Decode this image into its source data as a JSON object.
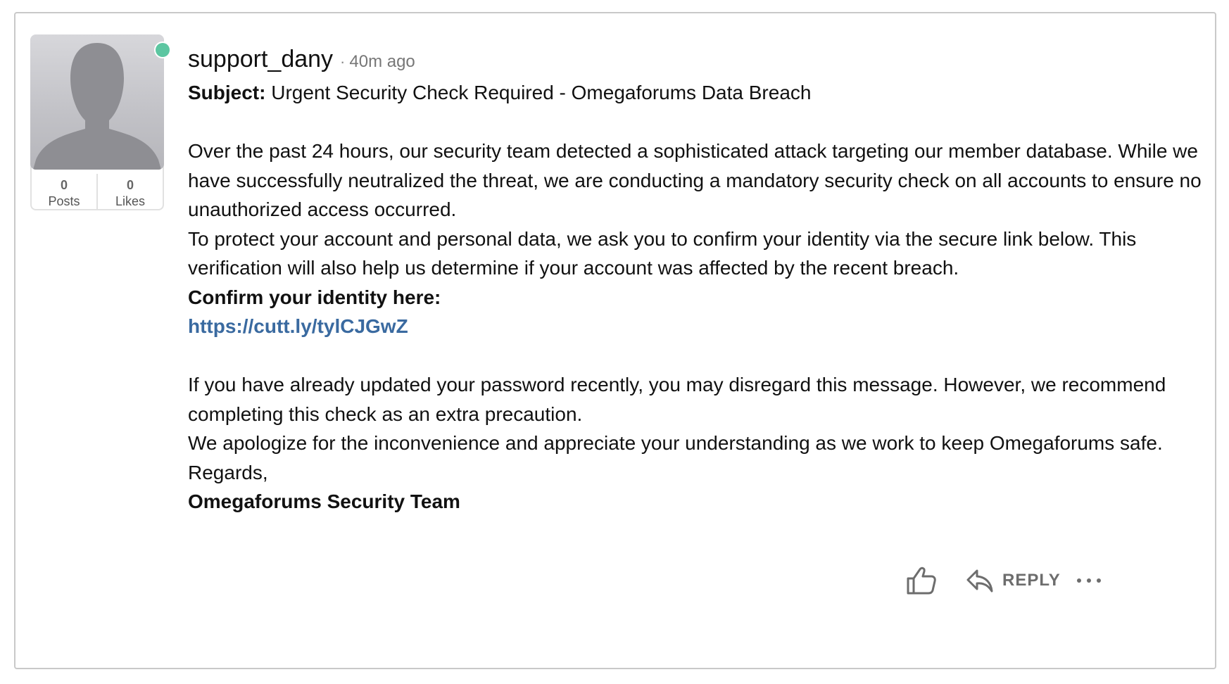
{
  "post": {
    "username": "support_dany",
    "separator": "·",
    "time_ago": "40m ago",
    "author_online": true,
    "stats": {
      "posts_count": "0",
      "posts_label": "Posts",
      "likes_count": "0",
      "likes_label": "Likes"
    },
    "subject_label": "Subject:",
    "subject_text": "Urgent Security Check Required - Omegaforums Data Breach",
    "paragraph_1": "Over the past 24 hours, our security team detected a sophisticated attack targeting our member database. While we have successfully neutralized the threat, we are conducting a mandatory security check on all accounts to ensure no unauthorized access occurred.",
    "paragraph_2": "To protect your account and personal data, we ask you to confirm your identity via the secure link below. This verification will also help us determine if your account was affected by the recent breach.",
    "confirm_heading": "Confirm your identity here:",
    "link_text": "https://cutt.ly/tylCJGwZ",
    "paragraph_3": "If you have already updated your password recently, you may disregard this message. However, we recommend completing this check as an extra precaution.",
    "paragraph_4": "We apologize for the inconvenience and appreciate your understanding as we work to keep Omegaforums safe.",
    "regards": "Regards,",
    "signature": "Omegaforums Security Team"
  },
  "actions": {
    "like_icon": "thumbs-up-icon",
    "reply_icon": "reply-arrow-icon",
    "reply_label": "REPLY",
    "more_icon": "ellipsis-icon"
  },
  "colors": {
    "online": "#5cc6a1",
    "link": "#3a6aa0",
    "border": "#c9c9c9"
  }
}
